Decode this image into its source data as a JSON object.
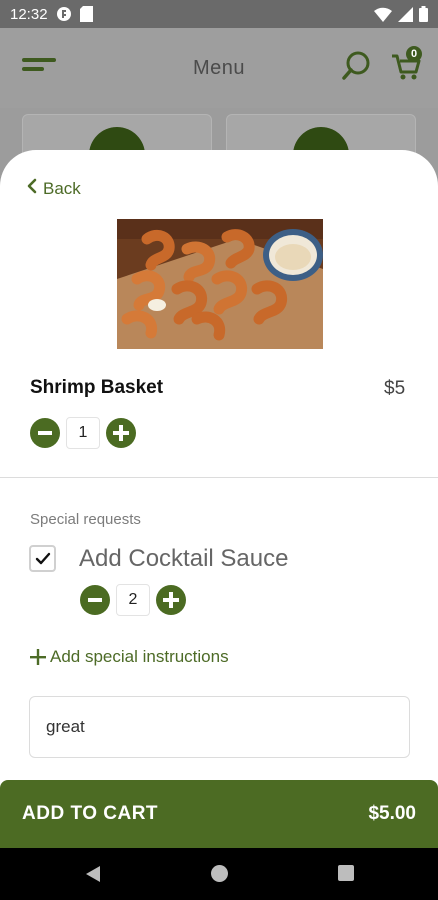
{
  "status_bar": {
    "time": "12:32"
  },
  "header": {
    "title": "Menu",
    "cart_count": "0"
  },
  "sheet": {
    "back_label": "Back",
    "item": {
      "name": "Shrimp Basket",
      "price": "$5",
      "quantity": "1"
    },
    "special": {
      "section_label": "Special requests",
      "option_label": "Add Cocktail Sauce",
      "option_checked": true,
      "option_quantity": "2"
    },
    "add_instructions_label": "Add special instructions",
    "instructions_value": "great"
  },
  "cart_bar": {
    "label": "ADD TO CART",
    "total": "$5.00"
  },
  "colors": {
    "brand_green": "#4c6b23",
    "dark_green": "#2f4a12"
  },
  "icons": [
    "menu-icon",
    "search-icon",
    "cart-icon",
    "chevron-left-icon",
    "minus-icon",
    "plus-icon",
    "check-icon",
    "wifi-icon",
    "signal-icon",
    "battery-icon"
  ]
}
